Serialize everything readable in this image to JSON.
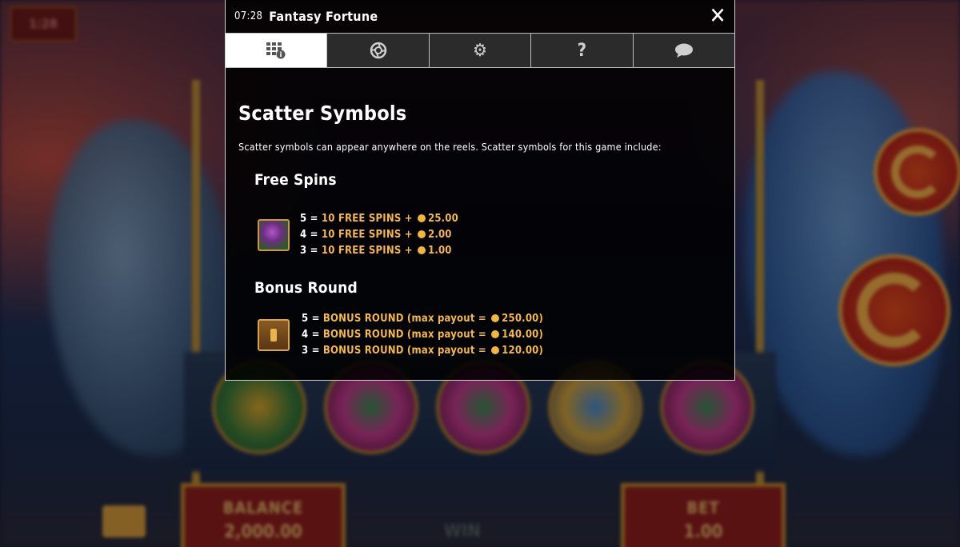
{
  "background": {
    "timer_text": "1:28",
    "balance_label": "BALANCE",
    "balance_value": "2,000.00",
    "bet_label": "BET",
    "bet_value": "1.00",
    "win_label": "WIN"
  },
  "modal": {
    "clock": "07:28",
    "title": "Fantasy Fortune",
    "close_glyph": "✕",
    "tabs": [
      {
        "name": "paytable-info-icon",
        "glyph": "▦",
        "active": true
      },
      {
        "name": "autoplay-icon",
        "glyph": "✪",
        "active": false
      },
      {
        "name": "settings-gear-icon",
        "glyph": "⚙",
        "active": false
      },
      {
        "name": "help-question-icon",
        "glyph": "?",
        "active": false
      },
      {
        "name": "chat-bubble-icon",
        "glyph": "💬",
        "active": false
      }
    ],
    "heading": "Scatter Symbols",
    "intro": "Scatter symbols can appear anywhere on the reels. Scatter symbols for this game include:",
    "free_spins": {
      "heading": "Free Spins",
      "symbol": "witch-scatter-symbol",
      "rows": [
        {
          "count": "5",
          "text": "10 FREE SPINS + ",
          "amount": "25.00"
        },
        {
          "count": "4",
          "text": "10 FREE SPINS + ",
          "amount": "2.00"
        },
        {
          "count": "3",
          "text": "10 FREE SPINS + ",
          "amount": "1.00"
        }
      ]
    },
    "bonus_round": {
      "heading": "Bonus Round",
      "symbol": "treasure-chest-symbol",
      "rows": [
        {
          "count": "5",
          "text": "BONUS ROUND (max payout = ",
          "amount": "250.00",
          "close": ")"
        },
        {
          "count": "4",
          "text": "BONUS ROUND (max payout = ",
          "amount": "140.00",
          "close": ")"
        },
        {
          "count": "3",
          "text": "BONUS ROUND (max payout = ",
          "amount": "120.00",
          "close": ")"
        }
      ]
    },
    "colors": {
      "gold": "#f4b74a",
      "panel": "#000000",
      "tab_active": "#ffffff"
    }
  }
}
